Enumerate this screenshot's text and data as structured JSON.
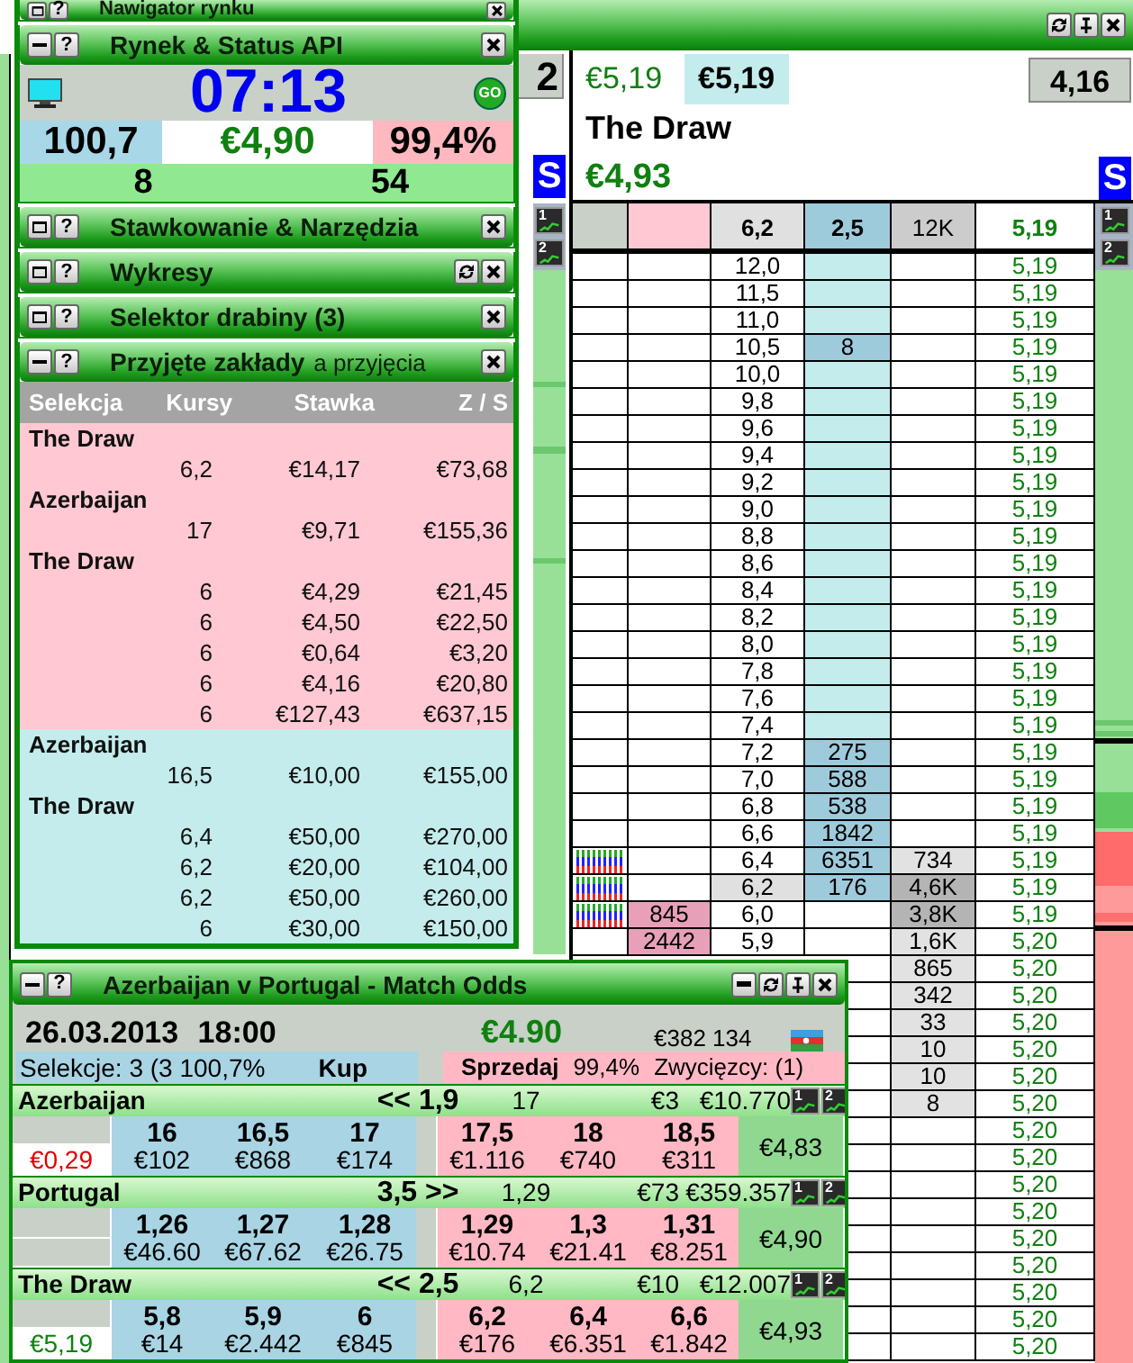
{
  "left_panel": {
    "sections": [
      {
        "kind": "navigator",
        "title": "Nawigator rynku",
        "expanded": false,
        "help": "?",
        "tools": [
          {
            "kind": "close"
          }
        ]
      },
      {
        "kind": "status",
        "title": "Rynek & Status API",
        "expanded": true,
        "help": "?",
        "tools": [
          {
            "kind": "close"
          }
        ],
        "status": {
          "clock": "07:13",
          "go": "GO",
          "back_book": "100,7",
          "balance": "€4,90",
          "lay_book": "99,4%",
          "left_count": "8",
          "right_count": "54"
        }
      },
      {
        "kind": "staking",
        "title": "Stawkowanie & Narzędzia",
        "expanded": false,
        "help": "?",
        "tools": [
          {
            "kind": "close"
          }
        ]
      },
      {
        "kind": "charts",
        "title": "Wykresy",
        "expanded": false,
        "help": "?",
        "tools": [
          {
            "kind": "refresh"
          },
          {
            "kind": "close"
          }
        ]
      },
      {
        "kind": "ladder_selector",
        "title": "Selektor drabiny (3)",
        "expanded": false,
        "help": "?",
        "tools": [
          {
            "kind": "close"
          }
        ]
      },
      {
        "kind": "bets",
        "title": "Przyjęte zakłady",
        "subtitle": "a przyjęcia",
        "expanded": true,
        "help": "?",
        "tools": [
          {
            "kind": "close"
          }
        ],
        "bets": {
          "columns": [
            "Selekcja",
            "Kursy",
            "Stawka",
            "Z / S"
          ],
          "groups": [
            {
              "kind": "lay",
              "selections": [
                {
                  "name": "The Draw",
                  "bets": [
                    {
                      "odds": "6,2",
                      "stake": "€14,17",
                      "result": "€73,68"
                    }
                  ]
                },
                {
                  "name": "Azerbaijan",
                  "bets": [
                    {
                      "odds": "17",
                      "stake": "€9,71",
                      "result": "€155,36"
                    }
                  ]
                },
                {
                  "name": "The Draw",
                  "bets": [
                    {
                      "odds": "6",
                      "stake": "€4,29",
                      "result": "€21,45"
                    },
                    {
                      "odds": "6",
                      "stake": "€4,50",
                      "result": "€22,50"
                    },
                    {
                      "odds": "6",
                      "stake": "€0,64",
                      "result": "€3,20"
                    },
                    {
                      "odds": "6",
                      "stake": "€4,16",
                      "result": "€20,80"
                    },
                    {
                      "odds": "6",
                      "stake": "€127,43",
                      "result": "€637,15"
                    }
                  ]
                }
              ]
            },
            {
              "kind": "back",
              "selections": [
                {
                  "name": "Azerbaijan",
                  "bets": [
                    {
                      "odds": "16,5",
                      "stake": "€10,00",
                      "result": "€155,00"
                    }
                  ]
                },
                {
                  "name": "The Draw",
                  "bets": [
                    {
                      "odds": "6,4",
                      "stake": "€50,00",
                      "result": "€270,00"
                    },
                    {
                      "odds": "6,2",
                      "stake": "€20,00",
                      "result": "€104,00"
                    },
                    {
                      "odds": "6,2",
                      "stake": "€50,00",
                      "result": "€260,00"
                    },
                    {
                      "odds": "6",
                      "stake": "€30,00",
                      "result": "€150,00"
                    }
                  ]
                }
              ]
            }
          ]
        }
      }
    ]
  },
  "ladder": {
    "tools": [
      {
        "kind": "refresh"
      },
      {
        "kind": "pin"
      },
      {
        "kind": "close"
      }
    ],
    "left_strip": {
      "odds": "2",
      "s": "S",
      "chart_buttons": [
        "1",
        "2"
      ]
    },
    "header": {
      "last_price": "€5,19",
      "price_box": "€5,19",
      "odds": "4,16",
      "runner": "The Draw",
      "profit": "€4,93",
      "s": "S"
    },
    "columns": {
      "price": "6,2",
      "back": "2,5",
      "traded": "12K",
      "ltp": "5,19"
    },
    "right_strip": {
      "chart_buttons": [
        "1",
        "2"
      ]
    },
    "rows": [
      {
        "price": "12,0",
        "kind": "back",
        "current": false,
        "marks": false,
        "highlight": false,
        "ltp": "5,19"
      },
      {
        "price": "11,5",
        "kind": "back",
        "current": false,
        "marks": false,
        "highlight": false,
        "ltp": "5,19"
      },
      {
        "price": "11,0",
        "kind": "back",
        "current": false,
        "marks": false,
        "highlight": false,
        "ltp": "5,19"
      },
      {
        "price": "10,5",
        "kind": "back",
        "back": "8",
        "current": false,
        "marks": false,
        "highlight": false,
        "ltp": "5,19"
      },
      {
        "price": "10,0",
        "kind": "back",
        "current": false,
        "marks": false,
        "highlight": false,
        "ltp": "5,19"
      },
      {
        "price": "9,8",
        "kind": "back",
        "current": false,
        "marks": false,
        "highlight": false,
        "ltp": "5,19"
      },
      {
        "price": "9,6",
        "kind": "back",
        "current": false,
        "marks": false,
        "highlight": false,
        "ltp": "5,19"
      },
      {
        "price": "9,4",
        "kind": "back",
        "current": false,
        "marks": false,
        "highlight": false,
        "ltp": "5,19"
      },
      {
        "price": "9,2",
        "kind": "back",
        "current": false,
        "marks": false,
        "highlight": false,
        "ltp": "5,19"
      },
      {
        "price": "9,0",
        "kind": "back",
        "current": false,
        "marks": false,
        "highlight": false,
        "ltp": "5,19"
      },
      {
        "price": "8,8",
        "kind": "back",
        "current": false,
        "marks": false,
        "highlight": false,
        "ltp": "5,19"
      },
      {
        "price": "8,6",
        "kind": "back",
        "current": false,
        "marks": false,
        "highlight": false,
        "ltp": "5,19"
      },
      {
        "price": "8,4",
        "kind": "back",
        "current": false,
        "marks": false,
        "highlight": false,
        "ltp": "5,19"
      },
      {
        "price": "8,2",
        "kind": "back",
        "current": false,
        "marks": false,
        "highlight": false,
        "ltp": "5,19"
      },
      {
        "price": "8,0",
        "kind": "back",
        "current": false,
        "marks": false,
        "highlight": false,
        "ltp": "5,19"
      },
      {
        "price": "7,8",
        "kind": "back",
        "current": false,
        "marks": false,
        "highlight": false,
        "ltp": "5,19"
      },
      {
        "price": "7,6",
        "kind": "back",
        "current": false,
        "marks": false,
        "highlight": false,
        "ltp": "5,19"
      },
      {
        "price": "7,4",
        "kind": "back",
        "current": false,
        "marks": false,
        "highlight": false,
        "ltp": "5,19"
      },
      {
        "price": "7,2",
        "kind": "back",
        "back": "275",
        "current": false,
        "marks": false,
        "highlight": false,
        "ltp": "5,19"
      },
      {
        "price": "7,0",
        "kind": "back",
        "back": "588",
        "current": false,
        "marks": false,
        "highlight": false,
        "ltp": "5,19"
      },
      {
        "price": "6,8",
        "kind": "back",
        "back": "538",
        "current": false,
        "marks": false,
        "highlight": false,
        "ltp": "5,19"
      },
      {
        "price": "6,6",
        "kind": "back",
        "back": "1842",
        "current": false,
        "marks": false,
        "highlight": false,
        "ltp": "5,19"
      },
      {
        "price": "6,4",
        "kind": "back",
        "back": "6351",
        "traded": "734",
        "current": false,
        "marks": true,
        "highlight": false,
        "ltp": "5,19"
      },
      {
        "price": "6,2",
        "kind": "back",
        "back": "176",
        "traded": "4,6K",
        "current": true,
        "marks": true,
        "highlight": true,
        "ltp": "5,19"
      },
      {
        "price": "6,0",
        "kind": "lay",
        "lay": "845",
        "traded": "3,8K",
        "current": false,
        "marks": true,
        "highlight": true,
        "ltp": "5,19"
      },
      {
        "price": "5,9",
        "kind": "lay",
        "lay": "2442",
        "traded": "1,6K",
        "current": false,
        "marks": false,
        "highlight": false,
        "ltp": "5,20"
      },
      {
        "traded": "865",
        "highlight": false,
        "ltp": "5,20"
      },
      {
        "traded": "342",
        "highlight": false,
        "ltp": "5,20"
      },
      {
        "traded": "33",
        "highlight": false,
        "ltp": "5,20"
      },
      {
        "traded": "10",
        "highlight": false,
        "ltp": "5,20"
      },
      {
        "traded": "10",
        "highlight": false,
        "ltp": "5,20"
      },
      {
        "traded": "8",
        "highlight": false,
        "ltp": "5,20"
      },
      {
        "highlight": false,
        "ltp": "5,20"
      },
      {
        "highlight": false,
        "ltp": "5,20"
      },
      {
        "highlight": false,
        "ltp": "5,20"
      },
      {
        "highlight": false,
        "ltp": "5,20"
      },
      {
        "highlight": false,
        "ltp": "5,20"
      },
      {
        "highlight": false,
        "ltp": "5,20"
      },
      {
        "highlight": false,
        "ltp": "5,20"
      },
      {
        "highlight": false,
        "ltp": "5,20"
      },
      {
        "highlight": false,
        "ltp": "5,20"
      }
    ]
  },
  "market": {
    "title": "Azerbaijan v Portugal - Match Odds",
    "expanded": true,
    "help": "?",
    "tools": [
      {
        "kind": "minimize"
      },
      {
        "kind": "refresh"
      },
      {
        "kind": "pin"
      },
      {
        "kind": "close"
      }
    ],
    "date": "26.03.2013 18:00",
    "matched": "€4.90",
    "total": "€382 134",
    "selections": "Selekcje: 3 (3 100,7%",
    "back_label": "Kup",
    "lay_label": "Sprzedaj",
    "lay_book": "99,4%",
    "winners": "Zwycięzcy: (1)",
    "runners": [
      {
        "name": "Azerbaijan",
        "last": "<< 1,9",
        "ltp": "17",
        "matched": "€3",
        "total": "€10.770",
        "chart_buttons": [
          "1",
          "2"
        ],
        "back": [
          {
            "odds": "16",
            "amount": "€102"
          },
          {
            "odds": "16,5",
            "amount": "€868"
          },
          {
            "odds": "17",
            "amount": "€174"
          }
        ],
        "lay": [
          {
            "odds": "17,5",
            "amount": "€1.116"
          },
          {
            "odds": "18",
            "amount": "€740"
          },
          {
            "odds": "18,5",
            "amount": "€311"
          }
        ],
        "position": {
          "text": "€0,29",
          "kind": "loss"
        },
        "result": "€4,83"
      },
      {
        "name": "Portugal",
        "last": "3,5 >>",
        "ltp": "1,29",
        "matched": "€73",
        "total": "€359.357",
        "chart_buttons": [
          "1",
          "2"
        ],
        "back": [
          {
            "odds": "1,26",
            "amount": "€46.60"
          },
          {
            "odds": "1,27",
            "amount": "€67.62"
          },
          {
            "odds": "1,28",
            "amount": "€26.75"
          }
        ],
        "lay": [
          {
            "odds": "1,29",
            "amount": "€10.74"
          },
          {
            "odds": "1,3",
            "amount": "€21.41"
          },
          {
            "odds": "1,31",
            "amount": "€8.251"
          }
        ],
        "result": "€4,90"
      },
      {
        "name": "The Draw",
        "last": "<< 2,5",
        "ltp": "6,2",
        "matched": "€10",
        "total": "€12.007",
        "chart_buttons": [
          "1",
          "2"
        ],
        "back": [
          {
            "odds": "5,8",
            "amount": "€14"
          },
          {
            "odds": "5,9",
            "amount": "€2.442"
          },
          {
            "odds": "6",
            "amount": "€845"
          }
        ],
        "lay": [
          {
            "odds": "6,2",
            "amount": "€176"
          },
          {
            "odds": "6,4",
            "amount": "€6.351"
          },
          {
            "odds": "6,6",
            "amount": "€1.842"
          }
        ],
        "position": {
          "text": "€5,19",
          "kind": "profit"
        },
        "result": "€4,93"
      }
    ]
  }
}
